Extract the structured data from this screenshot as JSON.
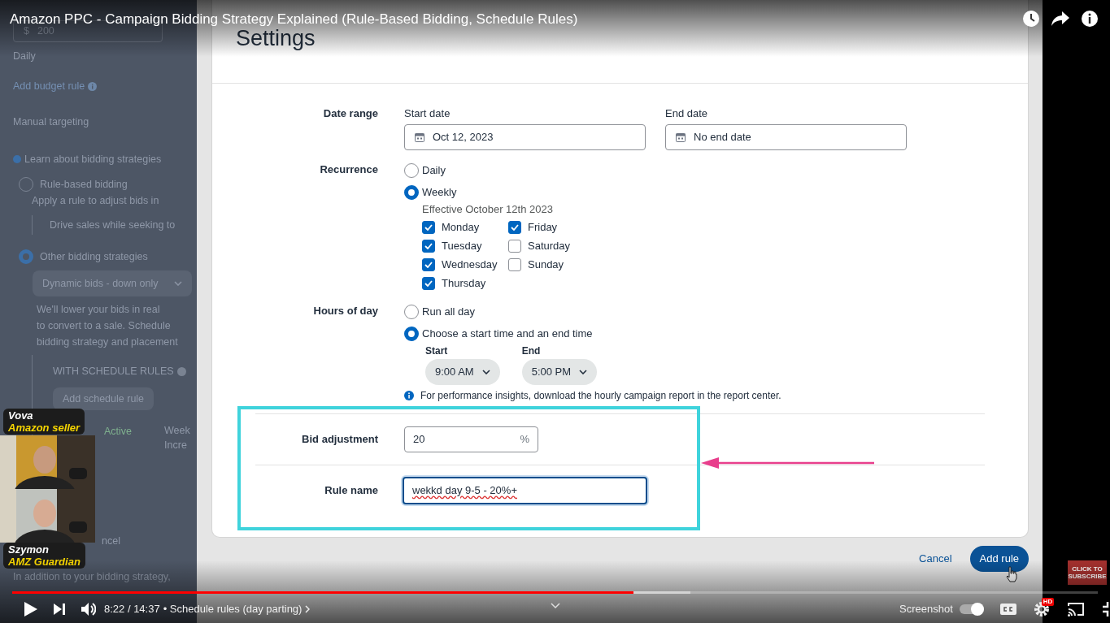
{
  "video": {
    "title": "Amazon PPC - Campaign Bidding Strategy Explained (Rule-Based Bidding, Schedule Rules)"
  },
  "background_page": {
    "budget_currency": "$",
    "budget_value": "200",
    "budget_period": "Daily",
    "budget_rule_link": "Add budget rule",
    "targeting": "Manual targeting",
    "learn_link": "Learn about bidding strategies",
    "strategies": [
      {
        "label": "Rule-based bidding",
        "selected": false,
        "description": "Apply a rule to adjust bids in",
        "note": "Drive sales while seeking to"
      },
      {
        "label": "Other bidding strategies",
        "selected": true,
        "dropdown": "Dynamic bids - down only",
        "description_lines": [
          "We'll lower your bids in real",
          "to convert to a sale. Schedule",
          "bidding strategy and placement"
        ]
      }
    ],
    "schedule_heading": "WITH SCHEDULE RULES",
    "schedule_button": "Add schedule rule",
    "rule_status": "Active",
    "rule_text_lines": [
      "Week",
      "Incre"
    ],
    "cancel_fragment": "ncel",
    "footer_text": "In addition to your bidding strategy,"
  },
  "webcams": [
    {
      "name": "Vova",
      "role": "Amazon seller"
    },
    {
      "name": "Szymon",
      "role": "AMZ Guardian"
    }
  ],
  "dialog": {
    "title": "Settings",
    "date_range": {
      "label": "Date range",
      "start": {
        "label": "Start date",
        "value": "Oct 12, 2023"
      },
      "end": {
        "label": "End date",
        "value": "No end date"
      }
    },
    "recurrence": {
      "label": "Recurrence",
      "options": [
        {
          "label": "Daily",
          "selected": false
        },
        {
          "label": "Weekly",
          "selected": true
        }
      ],
      "effective": "Effective October 12th 2023",
      "days": [
        {
          "label": "Monday",
          "checked": true
        },
        {
          "label": "Tuesday",
          "checked": true
        },
        {
          "label": "Wednesday",
          "checked": true
        },
        {
          "label": "Thursday",
          "checked": true
        },
        {
          "label": "Friday",
          "checked": true
        },
        {
          "label": "Saturday",
          "checked": false
        },
        {
          "label": "Sunday",
          "checked": false
        }
      ]
    },
    "hours": {
      "label": "Hours of day",
      "options": [
        {
          "label": "Run all day",
          "selected": false
        },
        {
          "label": "Choose a start time and an end time",
          "selected": true
        }
      ],
      "start": {
        "label": "Start",
        "value": "9:00 AM"
      },
      "end": {
        "label": "End",
        "value": "5:00 PM"
      },
      "note": "For performance insights, download the hourly campaign report in the report center."
    },
    "bid_adjustment": {
      "label": "Bid adjustment",
      "value": "20",
      "unit": "%"
    },
    "rule_name": {
      "label": "Rule name",
      "value": "wekkd day 9-5 - 20%+",
      "focused": true
    },
    "buttons": [
      {
        "label": "Cancel",
        "kind": "link"
      },
      {
        "label": "Add rule",
        "kind": "primary"
      }
    ]
  },
  "subscribe_badge": "CLICK TO SUBSCRIBE",
  "player": {
    "progress": {
      "level": 0.572
    },
    "buffer": {
      "level": 0.625
    },
    "time": "8:22 / 14:37",
    "chapter": "• Schedule rules (day parting)",
    "extension_label": "Screenshot",
    "autoplay_toggle": {
      "on": true
    },
    "quality_badge": "HD"
  }
}
